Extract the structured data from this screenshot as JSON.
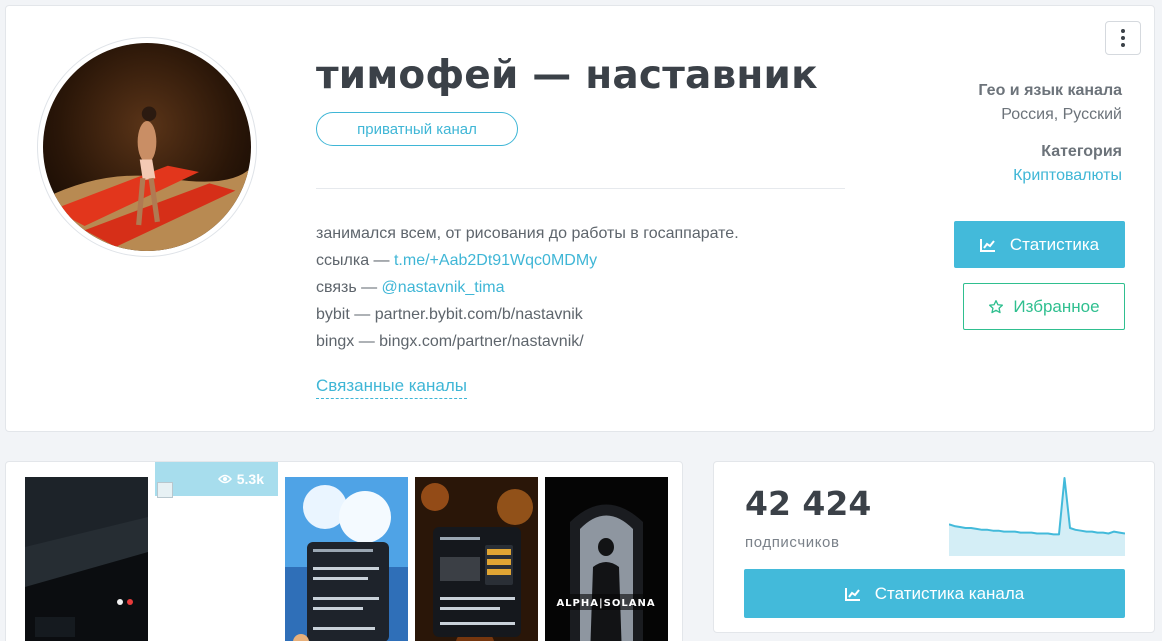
{
  "channel": {
    "title": "тимофей — наставник",
    "badge": "приватный канал",
    "description": {
      "line1": "занимался всем, от рисования до работы в госаппарате.",
      "link_prefix": "ссылка — ",
      "link": "t.me/+Aab2Dt91Wqc0MDMy",
      "contact_prefix": "связь — ",
      "contact": "@nastavnik_tima",
      "bybit": "bybit — partner.bybit.com/b/nastavnik",
      "bingx": "bingx — bingx.com/partner/nastavnik/"
    },
    "related_label": "Связанные каналы"
  },
  "side": {
    "geo_label": "Гео и язык канала",
    "geo_value": "Россия, Русский",
    "category_label": "Категория",
    "category_value": "Криптовалюты",
    "stats_button": "Статистика",
    "fav_button": "Избранное"
  },
  "posts": {
    "views": "5.3k"
  },
  "subscribers": {
    "count": "42 424",
    "label": "подписчиков",
    "button": "Статистика канала",
    "trend": [
      30,
      28,
      27,
      26,
      26,
      25,
      24,
      24,
      23,
      23,
      22,
      22,
      22,
      21,
      21,
      21,
      20,
      20,
      20,
      19,
      19,
      80,
      26,
      24,
      23,
      22,
      22,
      21,
      21,
      20,
      22,
      21,
      20
    ]
  },
  "colors": {
    "accent": "#43bada",
    "favorite": "#2fbf8f"
  },
  "icons": {
    "menu": "vertical-dots-icon",
    "stats": "line-chart-icon",
    "favorite": "star-outline-icon",
    "views": "eye-icon"
  }
}
